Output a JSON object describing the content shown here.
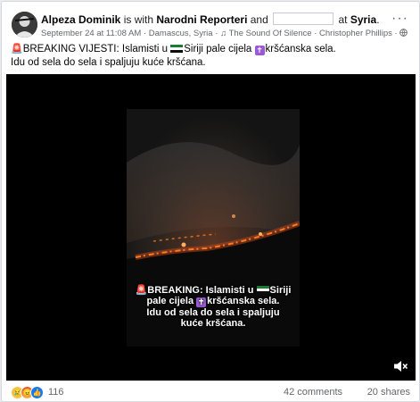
{
  "header": {
    "author": "Alpeza Dominik",
    "is_with": "is with",
    "tagged": "Narodni Reporteri",
    "and": "and",
    "at": "at",
    "place": "Syria",
    "period": ".",
    "more_label": "···"
  },
  "meta": {
    "date": "September 24 at 11:08 AM",
    "sep1": "·",
    "location": "Damascus, Syria",
    "sep2": "·",
    "music_icon": "♫",
    "music": "The Sound Of Silence · Christopher Phillips",
    "sep3": "·",
    "audience_icon": "globe-icon"
  },
  "post": {
    "line1_a": "BREAKING VIJESTI: Islamisti u",
    "line1_b": "Siriji pale cijela",
    "line1_c": "kršćanska sela.",
    "line2": "Idu od sela do sela i spaljuju kuće kršćana."
  },
  "video": {
    "caption_line1_a": "BREAKING: Islamisti u",
    "caption_line1_b": "Siriji",
    "caption_line2_a": "pale cijela",
    "caption_line2_b": "kršćanska sela.",
    "caption_line3": "Idu od sela do sela i spaljuju",
    "caption_line4": "kuće kršćana.",
    "colors": {
      "fire": "#ff7a1a",
      "glow": "#c0451c",
      "sky": "#1c1c1c"
    }
  },
  "footer": {
    "reaction_count": "116",
    "comments": "42 comments",
    "shares": "20 shares"
  },
  "colors": {
    "link": "#050505",
    "meta": "#65676b",
    "like_blue": "#1877f2"
  }
}
